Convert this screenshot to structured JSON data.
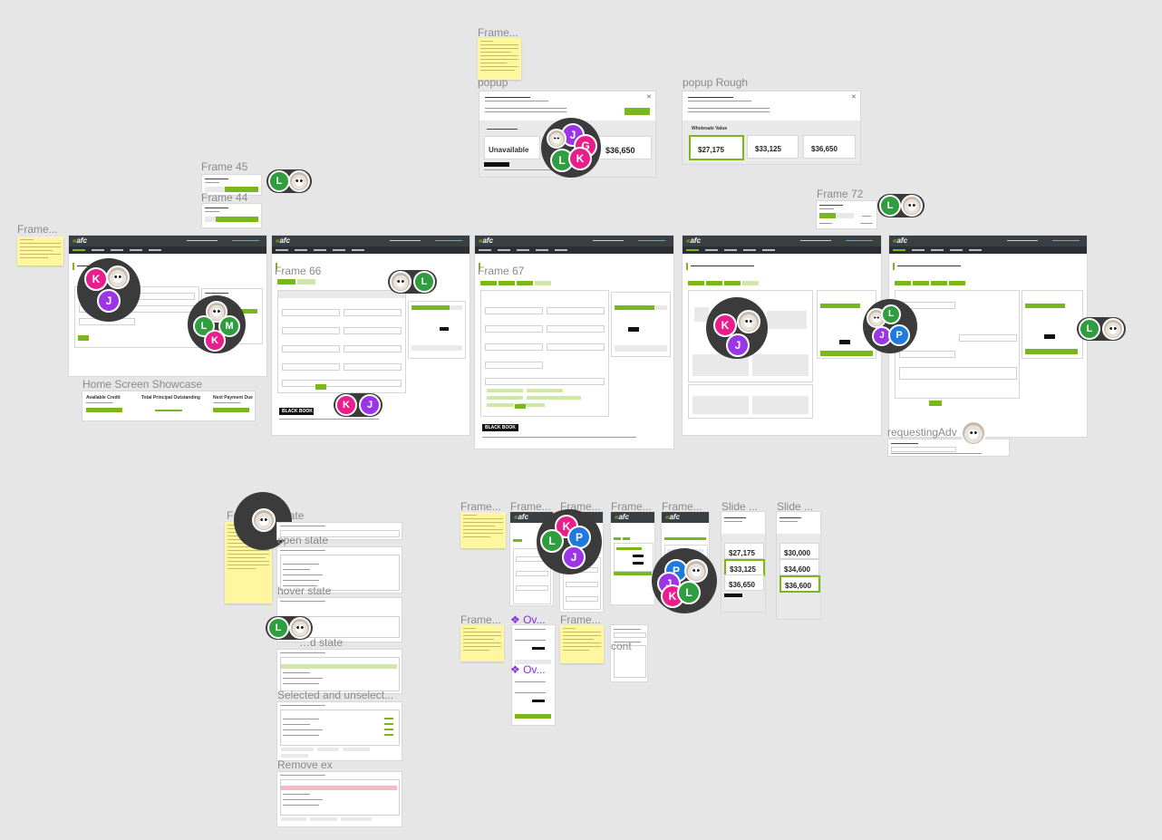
{
  "labels": {
    "frame_top": "Frame...",
    "popup": "popup",
    "popup_rough": "popup Rough",
    "frame45": "Frame 45",
    "frame44": "Frame 44",
    "frame72": "Frame 72",
    "frame_left": "Frame...",
    "frame66": "Frame 66",
    "frame67": "Frame 67",
    "home_showcase": "Home Screen Showcase",
    "requesting": "requestingAdv",
    "collapsed": "Fr…apsed state",
    "open": "open state",
    "hover": "hover state",
    "selected_state": "…d state",
    "sel_unsel": "Selected and unselect...",
    "remove": "Remove ex",
    "fr1": "Frame...",
    "fr2": "Frame...",
    "fr3": "Frame...",
    "fr4": "Frame...",
    "fr5": "Frame...",
    "slide1": "Slide ...",
    "slide2": "Slide ...",
    "fr6": "Frame...",
    "fr7": "Frame...",
    "ov1": "Ov...",
    "ov2": "Ov...",
    "cont": "cont"
  },
  "popup": {
    "rough_label": "Unavailable",
    "price3": "$36,650",
    "bb": "BLACK BOOK"
  },
  "popup_rough": {
    "wv": "Wholesale Value",
    "p1": "$27,175",
    "p2": "$33,125",
    "p3": "$36,650"
  },
  "home": {
    "c1_title": "Available Credit",
    "c2_title": "Total Principal Outstanding",
    "c3_title": "Next Payment Due"
  },
  "slide1": {
    "p1": "$27,175",
    "p2": "$33,125",
    "p3": "$36,650"
  },
  "slide2": {
    "p1": "$30,000",
    "p2": "$34,600",
    "p3": "$36,600"
  },
  "black_book": "BLACK BOOK",
  "app_logo": "afc",
  "avatars": {
    "j": "J",
    "g": "G",
    "l": "L",
    "k": "K",
    "m": "M",
    "p": "P"
  },
  "colors": {
    "accent": "#79b81c",
    "pink": "#e91e8c",
    "purple": "#9b35e6",
    "green": "#2e9e3f",
    "blue": "#1f7ae0",
    "header": "#3a3f44",
    "sticky": "#fff7a0"
  }
}
